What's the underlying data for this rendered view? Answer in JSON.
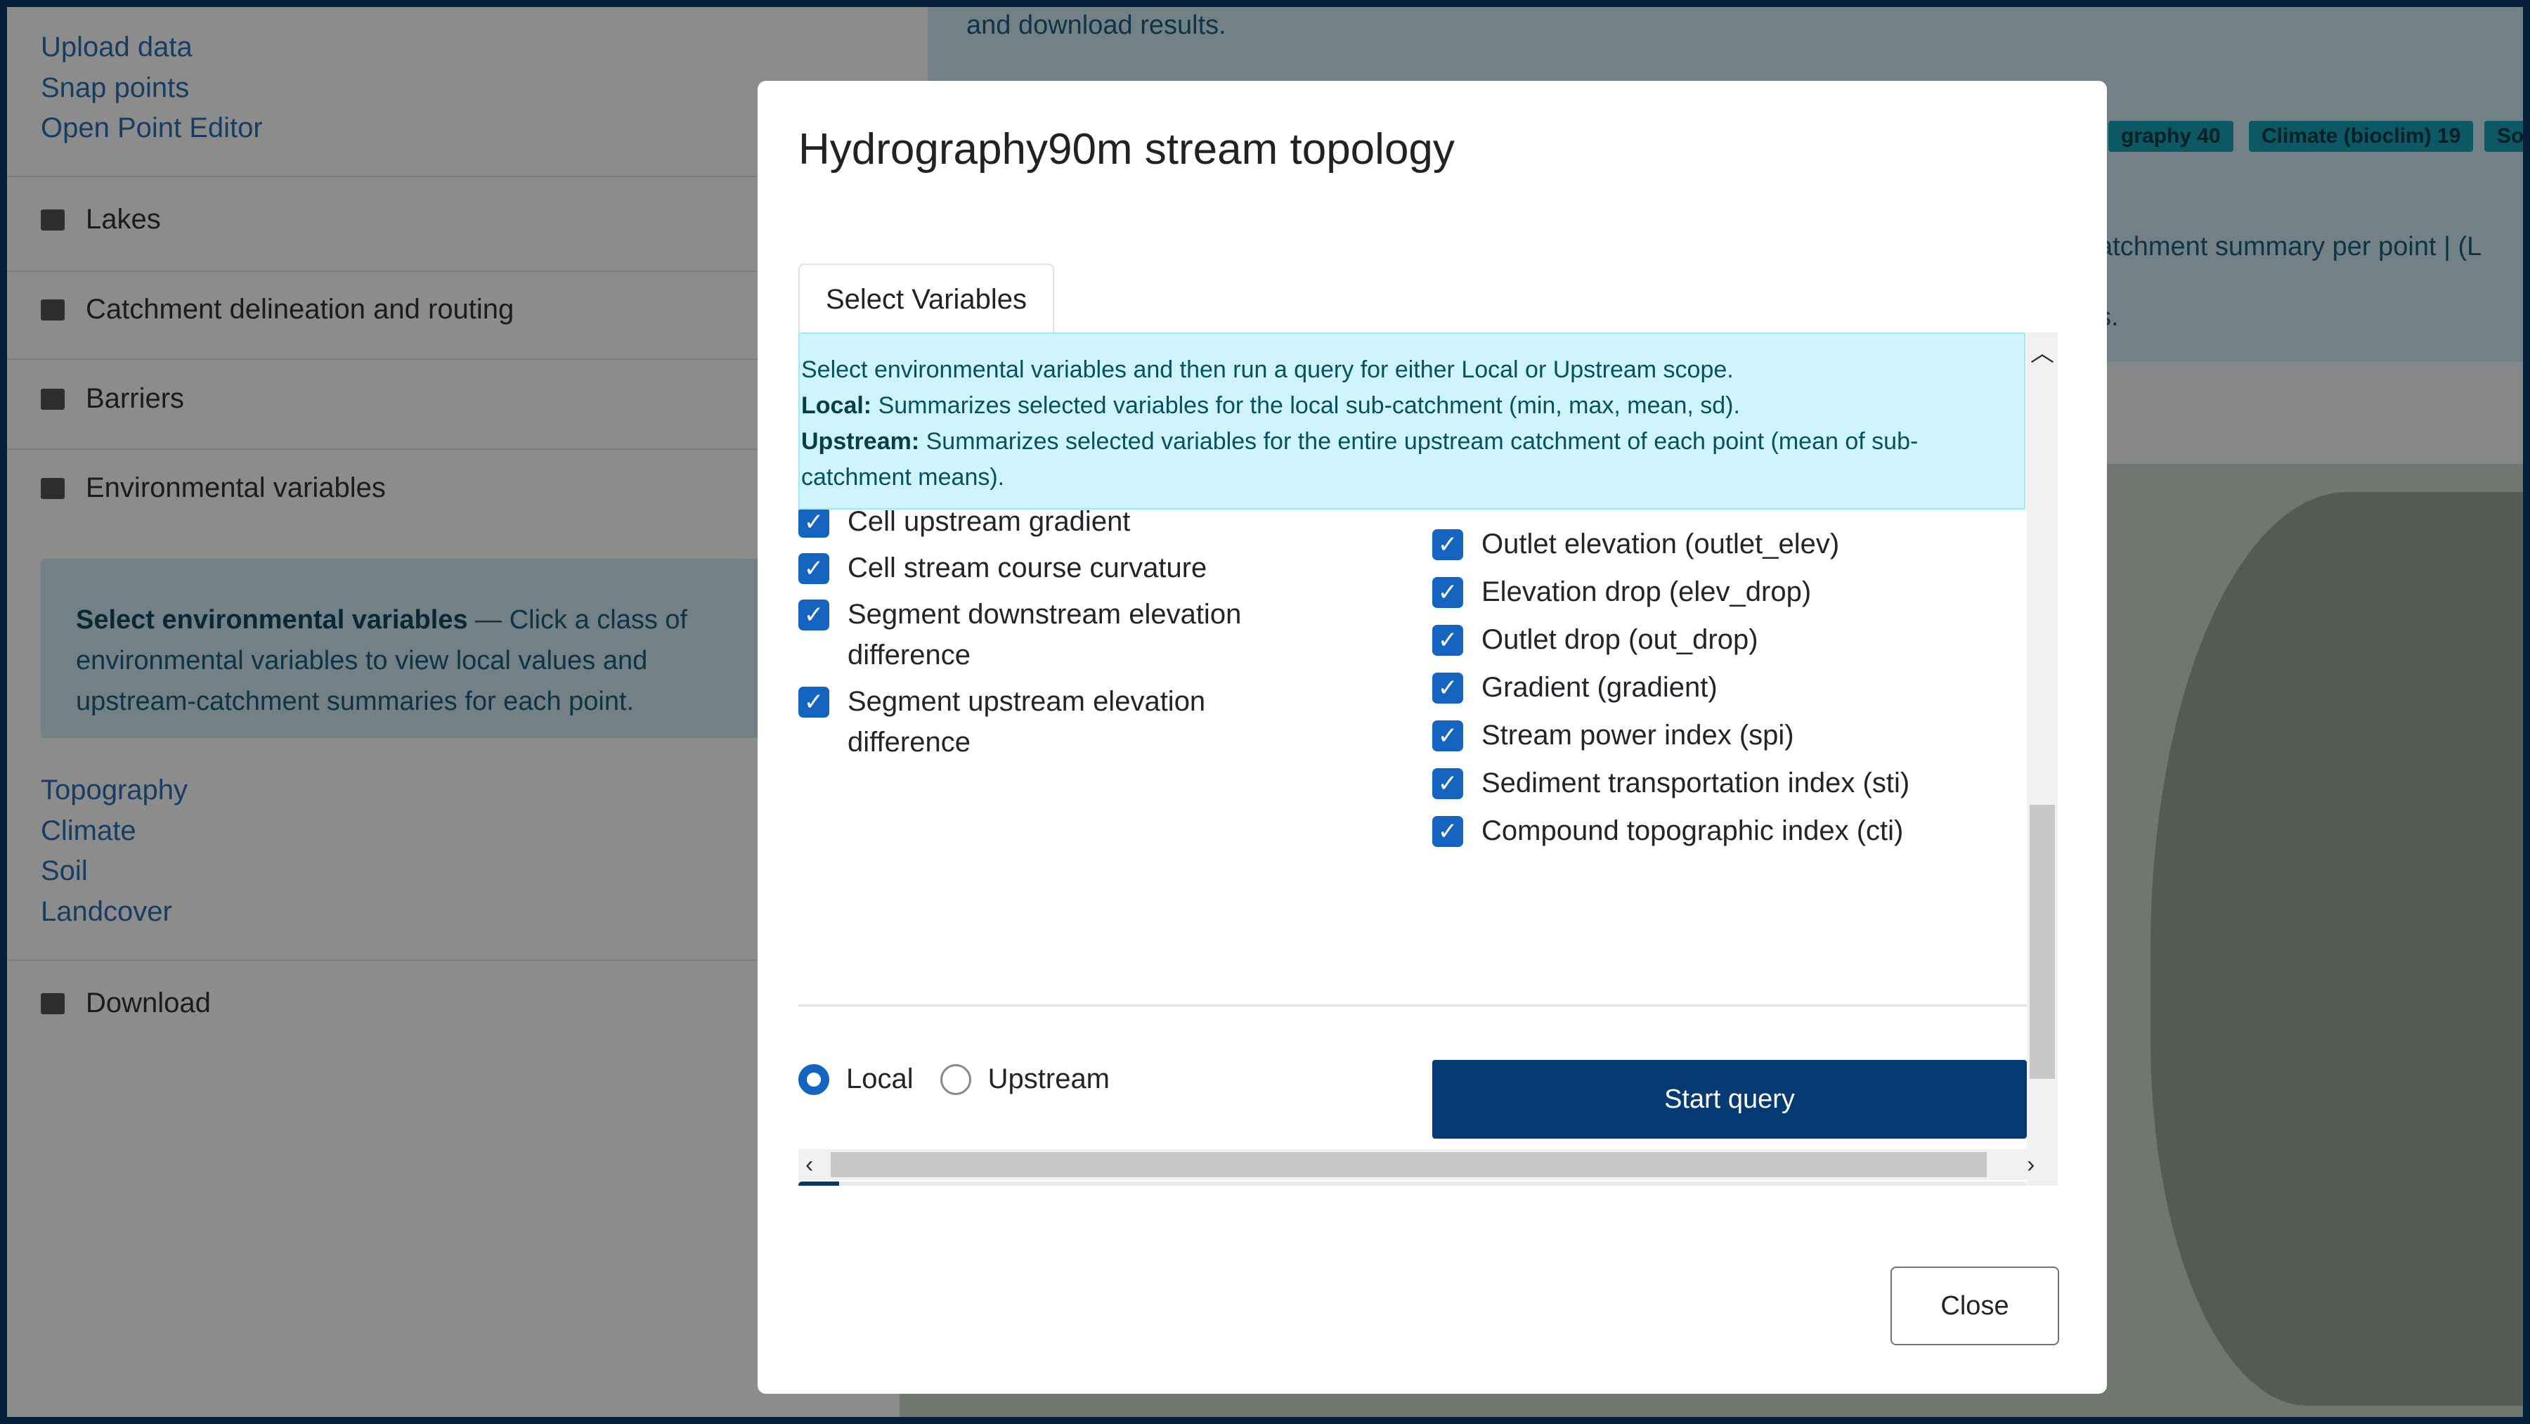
{
  "background": {
    "sidebar_links": [
      "Upload data",
      "Snap points",
      "Open Point Editor"
    ],
    "nav_items": [
      "Lakes",
      "Catchment delineation and routing",
      "Barriers",
      "Environmental variables"
    ],
    "info_title": "Select environmental variables",
    "info_text": " — Click a class of environmental variables to view local values and upstream-catchment summaries for each point.",
    "variable_classes": [
      "Topography",
      "Climate",
      "Soil",
      "Landcover"
    ],
    "download_label": "Download",
    "banner_line1": "and download results.",
    "banner_line2": "atchment summary per point | (L",
    "banner_line3": "s.",
    "chips": [
      "graphy 40",
      "Climate (bioclim) 19",
      "So"
    ]
  },
  "modal": {
    "title": "Hydrography90m stream topology",
    "tab_label": "Select Variables",
    "alert": {
      "intro": "Select environmental variables and then run a query for either Local or Upstream scope.",
      "local_label": "Local:",
      "local_text": " Summarizes selected variables for the local sub-catchment (min, max, mean, sd).",
      "upstream_label": "Upstream:",
      "upstream_text": " Summarizes selected variables for the entire upstream catchment of each point (mean of sub-catchment means)."
    },
    "left_variables": [
      "Cell upstream gradient",
      "Cell stream course curvature",
      "Segment downstream elevation difference",
      "Segment upstream elevation difference"
    ],
    "right_variables": [
      "Outlet elevation (outlet_elev)",
      "Elevation drop (elev_drop)",
      "Outlet drop (out_drop)",
      "Gradient (gradient)",
      "Stream power index (spi)",
      "Sediment transportation index (sti)",
      "Compound topographic index (cti)"
    ],
    "scope_options": [
      {
        "label": "Local",
        "selected": true
      },
      {
        "label": "Upstream",
        "selected": false
      }
    ],
    "start_label": "Start query",
    "progress": {
      "value": 0,
      "label": "0%"
    },
    "close_label": "Close"
  },
  "colors": {
    "primary": "#063a72",
    "checkbox": "#1565c0",
    "alert_bg": "#cff4fc",
    "alert_text": "#055160"
  }
}
